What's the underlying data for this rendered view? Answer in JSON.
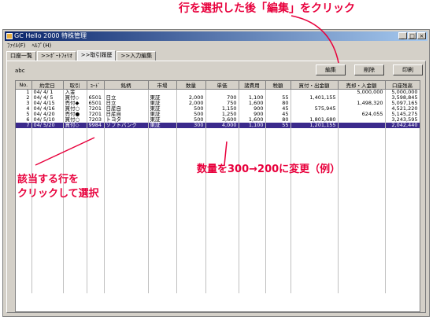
{
  "annotations": {
    "top": "行を選択した後「編集」をクリック",
    "left_line1": "該当する行を",
    "left_line2": "クリックして選択",
    "right": "数量を300→200に変更（例）"
  },
  "window": {
    "title": "GC Hello 2000 特株管理",
    "controls": [
      "_",
      "□",
      "×"
    ]
  },
  "menu": [
    "ﾌｧｲﾙ(F)",
    "ﾍﾙﾌﾟ(H)"
  ],
  "tabs": [
    "口座一覧",
    ">>ﾎﾟｰﾄﾌｫﾘｵ",
    ">>取引履歴",
    ">>入力編集"
  ],
  "active_tab": 2,
  "label_abc": "abc",
  "buttons": {
    "edit": "編集",
    "delete": "削除",
    "print": "印刷"
  },
  "columns": [
    "No.",
    "約定日",
    "取引",
    "ｺｰﾄﾞ",
    "銘柄",
    "市場",
    "数量",
    "単価",
    "諸費用",
    "税額",
    "買付・出金額",
    "売却・入金額",
    "口座残高"
  ],
  "rows": [
    [
      "1",
      "04/ 4/ 1",
      "入金",
      "",
      "",
      "",
      "",
      "",
      "",
      "",
      "",
      "5,000,000",
      "5,000,000"
    ],
    [
      "2",
      "04/ 4/ 5",
      "買付◇",
      "6501",
      "日立",
      "東証",
      "2,000",
      "700",
      "1,100",
      "55",
      "1,401,155",
      "",
      "3,598,845"
    ],
    [
      "3",
      "04/ 4/15",
      "売付◆",
      "6501",
      "日立",
      "東証",
      "2,000",
      "750",
      "1,600",
      "80",
      "",
      "1,498,320",
      "5,097,165"
    ],
    [
      "4",
      "04/ 4/16",
      "買付○",
      "7201",
      "日産自",
      "東証",
      "500",
      "1,150",
      "900",
      "45",
      "575,945",
      "",
      "4,521,220"
    ],
    [
      "5",
      "04/ 4/20",
      "売付●",
      "7201",
      "日産自",
      "東証",
      "500",
      "1,250",
      "900",
      "45",
      "",
      "624,055",
      "5,145,275"
    ],
    [
      "6",
      "04/ 5/10",
      "買付○",
      "7203",
      "トヨタ",
      "東証",
      "500",
      "3,600",
      "1,600",
      "80",
      "1,801,680",
      "",
      "3,243,595"
    ],
    [
      "7",
      "04/ 5/20",
      "買付◇",
      "9984",
      "ソフトバンク",
      "東証",
      "300",
      "4,000",
      "1,100",
      "55",
      "1,201,155",
      "",
      "2,042,440"
    ]
  ],
  "selected_row": 7,
  "accent_color": "#e8003c",
  "selection_color": "#3b2a8c"
}
